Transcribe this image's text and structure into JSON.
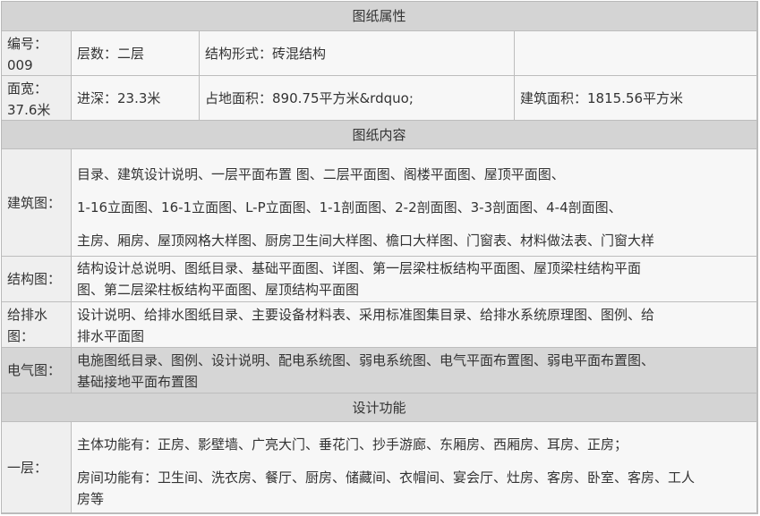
{
  "sections": {
    "attributes": "图纸属性",
    "contents": "图纸内容",
    "functions": "设计功能"
  },
  "attributes": {
    "number_label": "编号：",
    "number_value": "009",
    "floors": "层数：二层",
    "structure": "结构形式：砖混结构",
    "width_label": "面宽：",
    "width_value": "37.6米",
    "depth": "进深：23.3米",
    "land_area": "占地面积：890.75平方米&rdquo;",
    "building_area": "建筑面积：1815.56平方米"
  },
  "contents": {
    "architecture": {
      "label": "建筑图：",
      "lines": [
        "目录、建筑设计说明、一层平面布置 图、二层平面图、阁楼平面图、屋顶平面图、",
        "1-16立面图、16-1立面图、L-P立面图、1-1剖面图、2-2剖面图、3-3剖面图、4-4剖面图、",
        "主房、厢房、屋顶网格大样图、厨房卫生间大样图、檐口大样图、门窗表、材料做法表、门窗大样"
      ]
    },
    "structure": {
      "label": "结构图：",
      "lines": [
        "结构设计总说明、图纸目录、基础平面图、详图、第一层梁柱板结构平面图、屋顶梁柱结构平面",
        "图、第二层梁柱板结构平面图、屋顶结构平面图"
      ]
    },
    "plumbing": {
      "label_line1": "给排水",
      "label_line2": "图：",
      "lines": [
        "设计说明、给排水图纸目录、主要设备材料表、采用标准图集目录、给排水系统原理图、图例、给",
        "排水平面图"
      ]
    },
    "electrical": {
      "label": "电气图：",
      "lines": [
        "电施图纸目录、图例、设计说明、配电系统图、弱电系统图、电气平面布置图、弱电平面布置图、",
        "基础接地平面布置图"
      ]
    }
  },
  "functions": {
    "first_floor": {
      "label": "一层：",
      "main": "主体功能有：正房、影壁墙、广亮大门、垂花门、抄手游廊、东厢房、西厢房、耳房、正房；",
      "rooms_line1": "房间功能有：卫生间、洗衣房、餐厅、厨房、储藏间、衣帽间、宴会厅、灶房、客房、卧室、客房、工人",
      "rooms_line2": "房等"
    }
  }
}
